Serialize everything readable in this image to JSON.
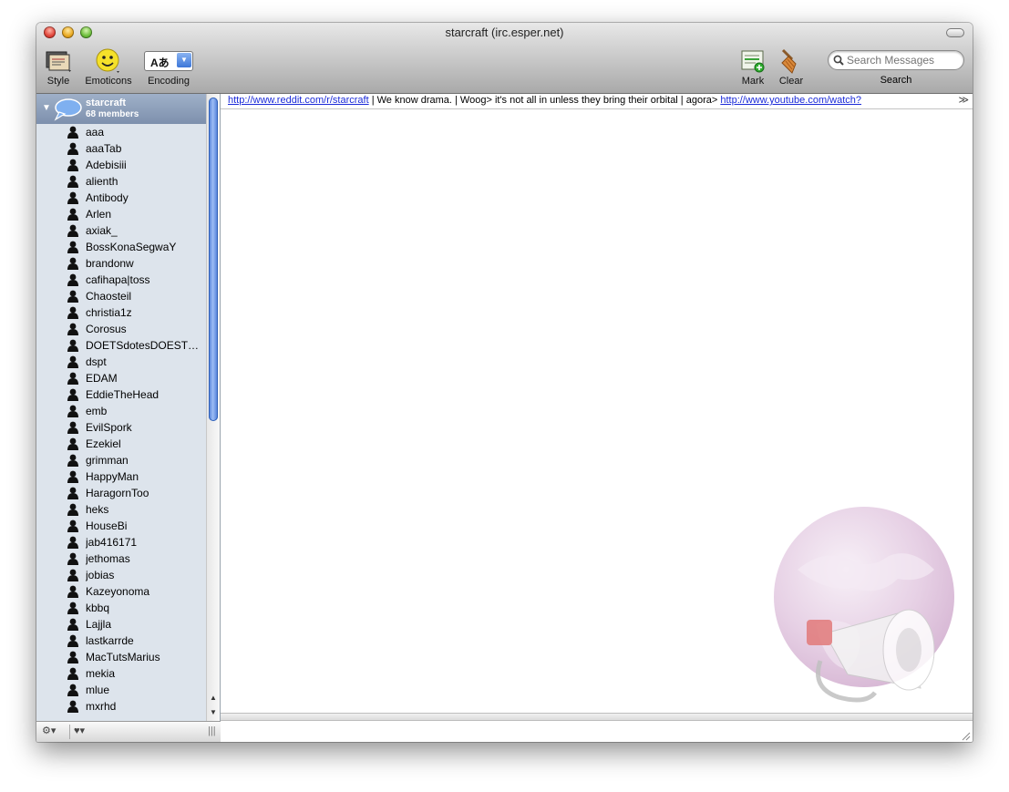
{
  "window": {
    "title": "starcraft (irc.esper.net)"
  },
  "toolbar": {
    "style_label": "Style",
    "emoticons_label": "Emoticons",
    "encoding_label": "Encoding",
    "encoding_glyph": "Aあ",
    "mark_label": "Mark",
    "clear_label": "Clear",
    "search_label": "Search",
    "search_placeholder": "Search Messages"
  },
  "channel": {
    "name": "starcraft",
    "members_count": "68 members",
    "members": [
      {
        "name": "aaa"
      },
      {
        "name": "aaaTab"
      },
      {
        "name": "Adebisiii"
      },
      {
        "name": "alienth"
      },
      {
        "name": "Antibody"
      },
      {
        "name": "Arlen"
      },
      {
        "name": "axiak_"
      },
      {
        "name": "BossKonaSegwaY"
      },
      {
        "name": "brandonw"
      },
      {
        "name": "cafihapa|toss"
      },
      {
        "name": "Chaosteil"
      },
      {
        "name": "christia1z"
      },
      {
        "name": "Corosus"
      },
      {
        "name": "DOETSdotesDOESTSd..."
      },
      {
        "name": "dspt"
      },
      {
        "name": "EDAM"
      },
      {
        "name": "EddieTheHead"
      },
      {
        "name": "emb"
      },
      {
        "name": "EvilSpork"
      },
      {
        "name": "Ezekiel"
      },
      {
        "name": "grimman"
      },
      {
        "name": "HappyMan"
      },
      {
        "name": "HaragornToo"
      },
      {
        "name": "heks"
      },
      {
        "name": "HouseBi"
      },
      {
        "name": "jab416171"
      },
      {
        "name": "jethomas"
      },
      {
        "name": "jobias"
      },
      {
        "name": "Kazeyonoma"
      },
      {
        "name": "kbbq"
      },
      {
        "name": "Lajjla"
      },
      {
        "name": "lastkarrde"
      },
      {
        "name": "MacTutsMarius"
      },
      {
        "name": "mekia"
      },
      {
        "name": "mlue"
      },
      {
        "name": "mxrhd"
      }
    ]
  },
  "topic": {
    "link1": "http://www.reddit.com/r/starcraft",
    "text": " | We know drama. | Woog> it's not all in unless they bring their orbital | agora> ",
    "link2": "http://www.youtube.com/watch?"
  },
  "colors": {
    "sidebar_bg": "#dde4ec",
    "header_bg": "#8a9cb8",
    "link": "#1a2ad8",
    "scroll_thumb": "#5a88dd"
  },
  "icons": {
    "style": "style-icon",
    "emoticons": "smiley-icon",
    "encoding": "encoding-icon",
    "mark": "mark-icon",
    "clear": "broom-icon",
    "search": "magnifier-icon",
    "gear": "gear-icon",
    "heart": "heart-icon"
  }
}
